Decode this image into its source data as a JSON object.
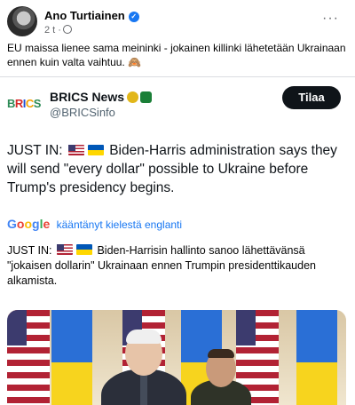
{
  "post": {
    "author": "Ano Turtiainen",
    "time": "2 t",
    "more_label": "···",
    "text": "EU maissa lienee sama meininki - jokainen killinki lähetetään Ukrainaan ennen kuin valta vaihtuu. 🙈"
  },
  "tweet": {
    "account_name": "BRICS News",
    "handle": "@BRICSinfo",
    "follow_label": "Tilaa",
    "logo_letters": [
      "B",
      "R",
      "I",
      "C",
      "S"
    ],
    "text_prefix": "JUST IN:",
    "text_body": "Biden-Harris administration says they will send \"every dollar\" possible to Ukraine before Trump's presidency begins.",
    "translate": {
      "brand_letters": [
        "G",
        "o",
        "o",
        "g",
        "l",
        "e"
      ],
      "label": "kääntänyt kielestä englanti"
    },
    "translated_prefix": "JUST IN:",
    "translated_body": "Biden-Harrisin hallinto sanoo lähettävänsä \"jokaisen dollarin\" Ukrainaan ennen Trumpin presidenttikauden alkamista."
  },
  "colors": {
    "facebook_blue": "#1877f2",
    "follow_button_bg": "#0f1419",
    "secondary_text": "#65676b"
  }
}
